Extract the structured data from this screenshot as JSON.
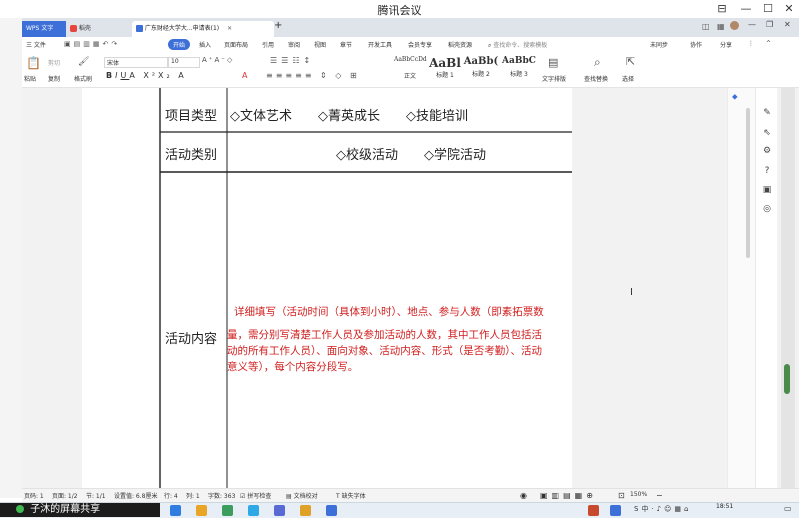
{
  "meeting": {
    "title": "腾讯会议"
  },
  "tabs": [
    {
      "label": "WPS 文字"
    },
    {
      "label": "稻壳"
    },
    {
      "label": "广东财经大学大...申请表(1)"
    }
  ],
  "menu": {
    "file": "三 文件",
    "start": "开始",
    "items": [
      "插入",
      "页面布局",
      "引用",
      "审阅",
      "视图",
      "章节",
      "开发工具",
      "会员专享",
      "稻壳资源"
    ],
    "search_placeholder": "查找命令、搜索模板",
    "right_items": [
      "未同步",
      "协作",
      "分享"
    ]
  },
  "ribbon": {
    "paste": "粘贴",
    "cut": "剪切",
    "copy": "复制",
    "format_painter": "格式刷",
    "font_name": "宋体",
    "font_size": "10",
    "styles": [
      {
        "preview": "AaBbCcDd",
        "name": "正文"
      },
      {
        "preview": "AaBl",
        "name": "标题 1"
      },
      {
        "preview": "AaBb(",
        "name": "标题 2"
      },
      {
        "preview": "AaBbC",
        "name": "标题 3"
      }
    ],
    "text_layout": "文字排版",
    "find_replace": "查找替换",
    "select": "选择"
  },
  "document": {
    "rows": [
      {
        "label": "项目类型",
        "options": [
          "◇文体艺术",
          "◇菁英成长",
          "◇技能培训"
        ]
      },
      {
        "label": "活动类别",
        "options": [
          "◇校级活动",
          "◇学院活动"
        ]
      },
      {
        "label": "活动内容",
        "content_lines": [
          "详细填写（活动时间（具体到小时）、地点、参与人数（即素拓票数",
          "量，需分别写清楚工作人员及参加活动的人数，其中工作人员包括活",
          "动的所有工作人员）、面向对象、活动内容、形式（是否考勤）、活动",
          "意义等），每个内容分段写。"
        ]
      }
    ]
  },
  "status": {
    "page_num": "页码: 1",
    "pages": "页面: 1/2",
    "section": "节: 1/1",
    "setting": "设置值: 6.8厘米",
    "row": "行: 4",
    "col": "列: 1",
    "word_count": "字数: 363",
    "spell_check": "拼写检查",
    "doc_proof": "文档校对",
    "missing_font": "缺失字体",
    "zoom": "150%"
  },
  "taskbar": {
    "share_text": "子沐的屏幕共享",
    "time": "18:51"
  },
  "colors": {
    "accent": "#3d6fd8",
    "red_text": "#d11f1f"
  }
}
